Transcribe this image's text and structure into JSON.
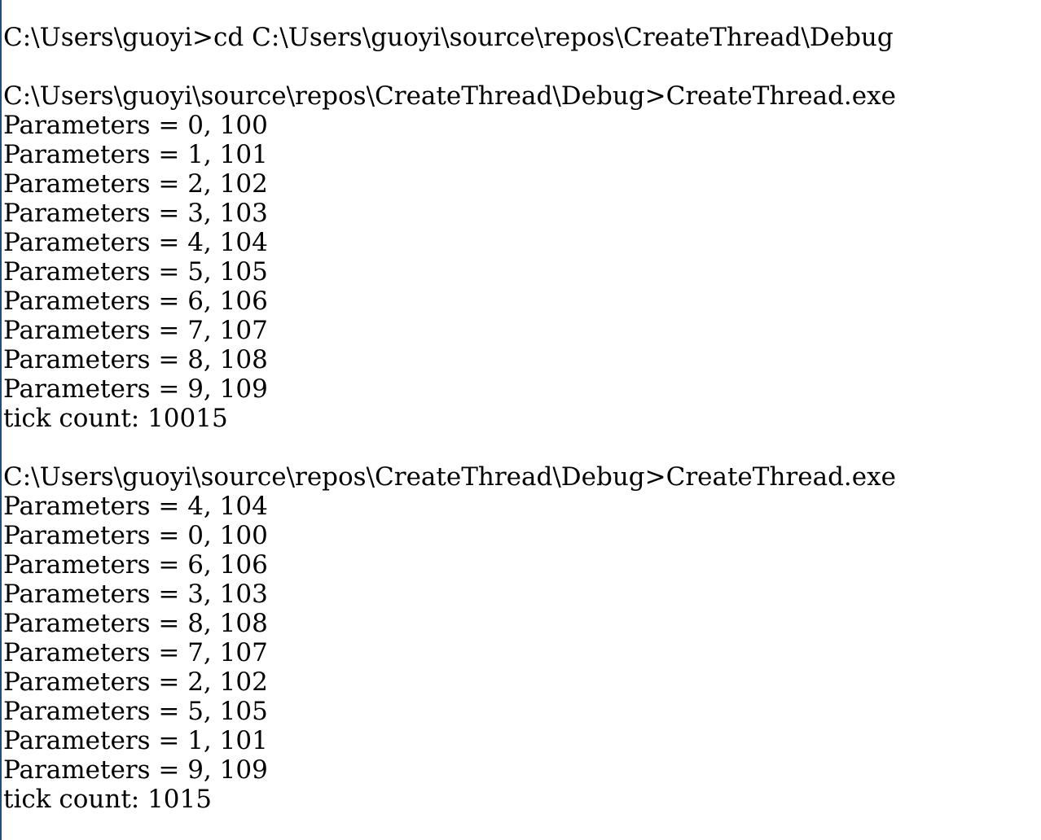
{
  "console": {
    "lines": [
      "C:\\Users\\guoyi>cd C:\\Users\\guoyi\\source\\repos\\CreateThread\\Debug",
      "",
      "C:\\Users\\guoyi\\source\\repos\\CreateThread\\Debug>CreateThread.exe",
      "Parameters = 0, 100",
      "Parameters = 1, 101",
      "Parameters = 2, 102",
      "Parameters = 3, 103",
      "Parameters = 4, 104",
      "Parameters = 5, 105",
      "Parameters = 6, 106",
      "Parameters = 7, 107",
      "Parameters = 8, 108",
      "Parameters = 9, 109",
      "tick count: 10015",
      "",
      "C:\\Users\\guoyi\\source\\repos\\CreateThread\\Debug>CreateThread.exe",
      "Parameters = 4, 104",
      "Parameters = 0, 100",
      "Parameters = 6, 106",
      "Parameters = 3, 103",
      "Parameters = 8, 108",
      "Parameters = 7, 107",
      "Parameters = 2, 102",
      "Parameters = 5, 105",
      "Parameters = 1, 101",
      "Parameters = 9, 109",
      "tick count: 1015"
    ]
  }
}
